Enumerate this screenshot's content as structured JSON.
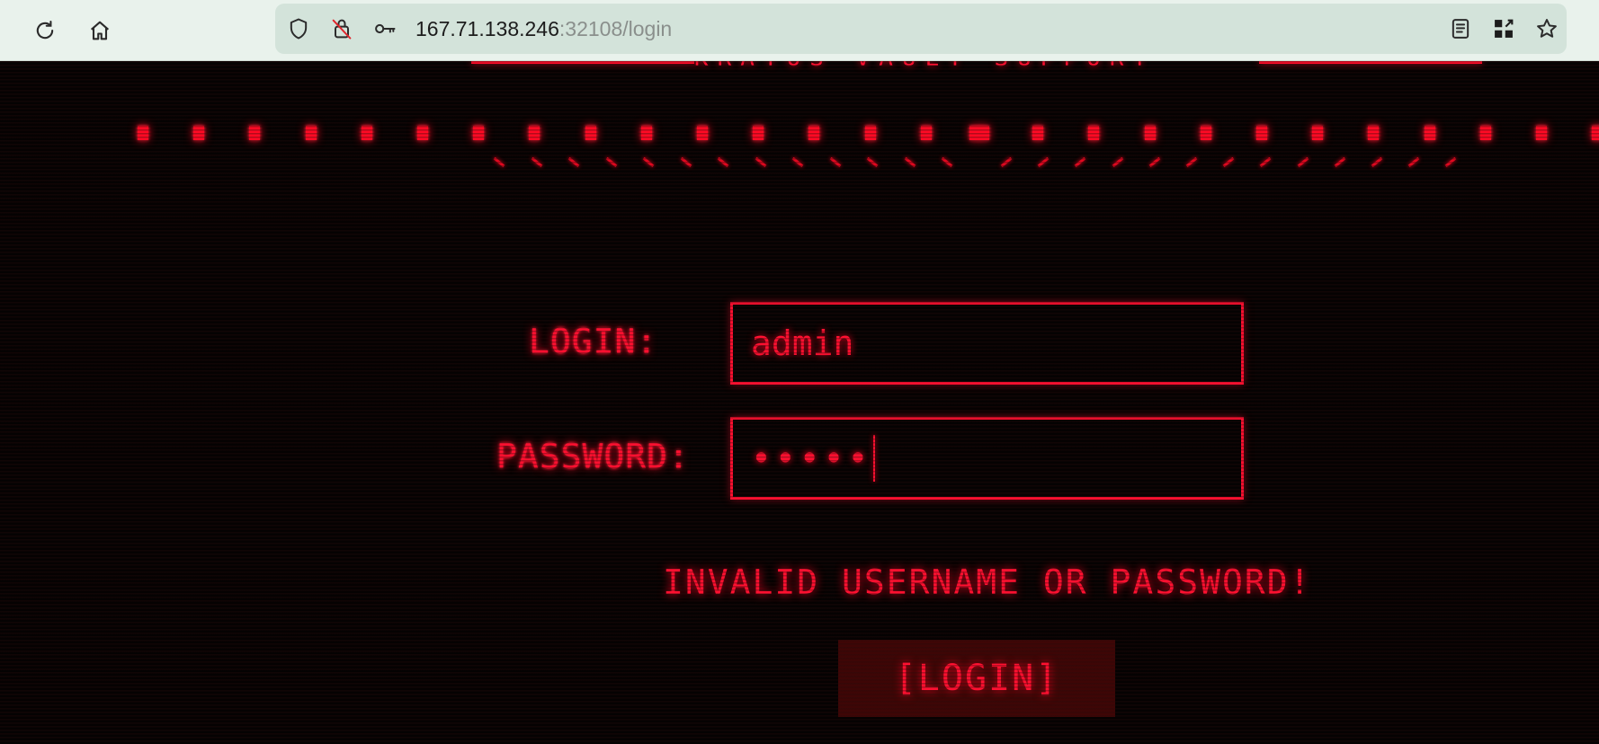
{
  "browser": {
    "url_host": "167.71.138.246",
    "url_rest": ":32108/login",
    "toolbar_icons": [
      "reload-icon",
      "home-icon"
    ],
    "url_icons": [
      "shield-icon",
      "insecure-lock-icon",
      "key-icon"
    ],
    "right_icons": [
      "reader-view-icon",
      "qr-code-icon",
      "bookmark-star-icon"
    ]
  },
  "page": {
    "banner_title": "KRATOS VAULT SUPPORT",
    "form": {
      "login_label": "LOGIN:",
      "login_value": "admin",
      "password_label": "PASSWORD:",
      "password_value": "•••••"
    },
    "error_message": "INVALID USERNAME OR PASSWORD!",
    "submit_label": "[LOGIN]"
  },
  "theme": {
    "accent": "#ff1030",
    "background": "#050202",
    "button_background": "#3e0606",
    "chrome_background": "#e9f2ec"
  }
}
